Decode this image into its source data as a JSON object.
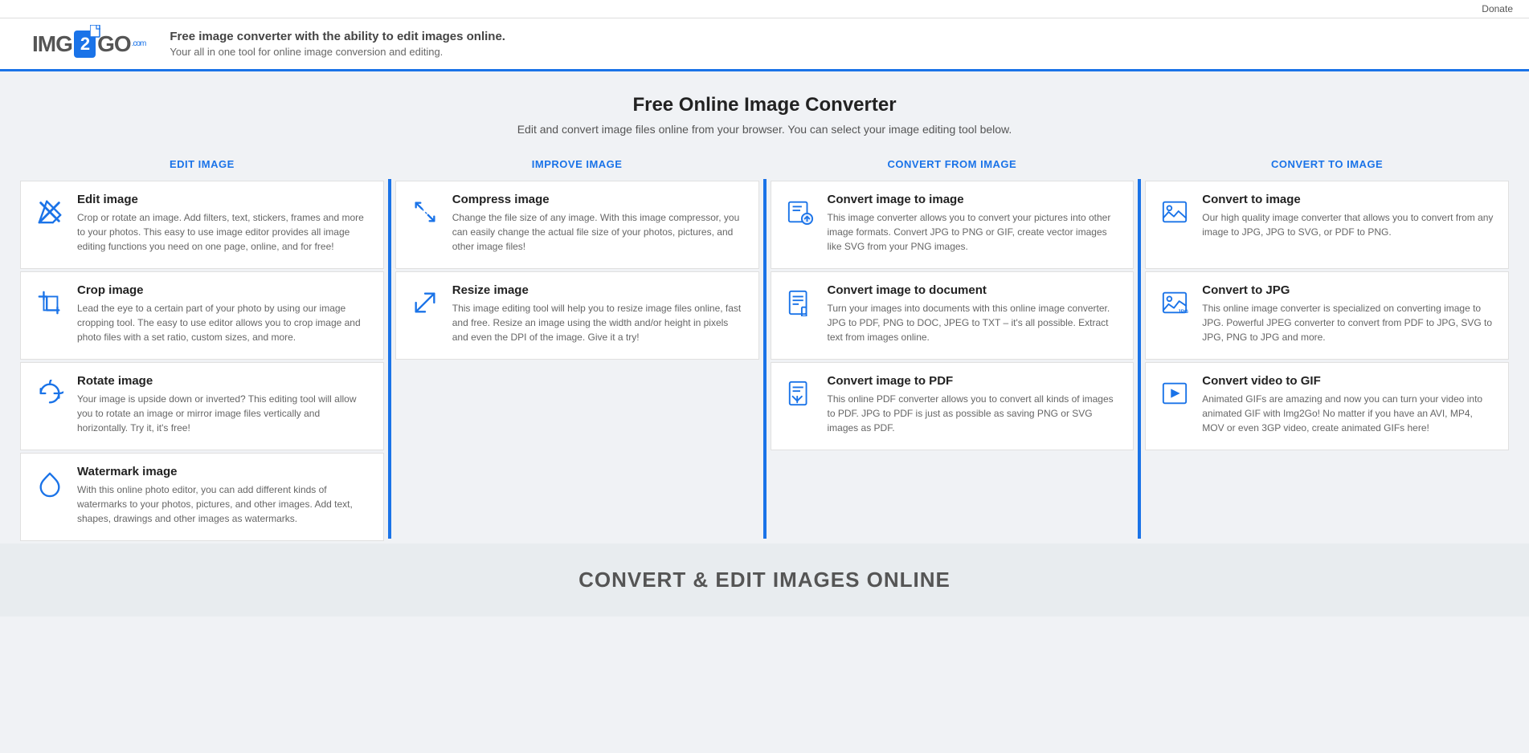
{
  "topbar": {
    "donate_label": "Donate"
  },
  "header": {
    "logo_text_left": "IMG",
    "logo_text_mid": "2",
    "logo_text_right": "GO",
    "logo_com": ".com",
    "tagline_bold": "Free image converter with the ability to edit images online.",
    "tagline_sub": "Your all in one tool for online image conversion and editing."
  },
  "hero": {
    "title": "Free Online Image Converter",
    "subtitle": "Edit and convert image files online from your browser. You can select your image editing tool below."
  },
  "columns": [
    {
      "id": "edit",
      "header": "EDIT IMAGE",
      "cards": [
        {
          "icon": "edit",
          "title": "Edit image",
          "description": "Crop or rotate an image. Add filters, text, stickers, frames and more to your photos. This easy to use image editor provides all image editing functions you need on one page, online, and for free!"
        },
        {
          "icon": "crop",
          "title": "Crop image",
          "description": "Lead the eye to a certain part of your photo by using our image cropping tool. The easy to use editor allows you to crop image and photo files with a set ratio, custom sizes, and more."
        },
        {
          "icon": "rotate",
          "title": "Rotate image",
          "description": "Your image is upside down or inverted? This editing tool will allow you to rotate an image or mirror image files vertically and horizontally. Try it, it's free!"
        },
        {
          "icon": "watermark",
          "title": "Watermark image",
          "description": "With this online photo editor, you can add different kinds of watermarks to your photos, pictures, and other images. Add text, shapes, drawings and other images as watermarks."
        }
      ]
    },
    {
      "id": "improve",
      "header": "IMPROVE IMAGE",
      "cards": [
        {
          "icon": "compress",
          "title": "Compress image",
          "description": "Change the file size of any image. With this image compressor, you can easily change the actual file size of your photos, pictures, and other image files!"
        },
        {
          "icon": "resize",
          "title": "Resize image",
          "description": "This image editing tool will help you to resize image files online, fast and free. Resize an image using the width and/or height in pixels and even the DPI of the image. Give it a try!"
        }
      ]
    },
    {
      "id": "convert-from",
      "header": "CONVERT FROM IMAGE",
      "cards": [
        {
          "icon": "convert-image",
          "title": "Convert image to image",
          "description": "This image converter allows you to convert your pictures into other image formats. Convert JPG to PNG or GIF, create vector images like SVG from your PNG images."
        },
        {
          "icon": "convert-doc",
          "title": "Convert image to document",
          "description": "Turn your images into documents with this online image converter. JPG to PDF, PNG to DOC, JPEG to TXT – it's all possible. Extract text from images online."
        },
        {
          "icon": "convert-pdf",
          "title": "Convert image to PDF",
          "description": "This online PDF converter allows you to convert all kinds of images to PDF. JPG to PDF is just as possible as saving PNG or SVG images as PDF."
        }
      ]
    },
    {
      "id": "convert-to",
      "header": "CONVERT TO IMAGE",
      "cards": [
        {
          "icon": "to-image",
          "title": "Convert to image",
          "description": "Our high quality image converter that allows you to convert from any image to JPG, JPG to SVG, or PDF to PNG."
        },
        {
          "icon": "to-jpg",
          "title": "Convert to JPG",
          "description": "This online image converter is specialized on converting image to JPG. Powerful JPEG converter to convert from PDF to JPG, SVG to JPG, PNG to JPG and more."
        },
        {
          "icon": "to-gif",
          "title": "Convert video to GIF",
          "description": "Animated GIFs are amazing and now you can turn your video into animated GIF with Img2Go! No matter if you have an AVI, MP4, MOV or even 3GP video, create animated GIFs here!"
        }
      ]
    }
  ],
  "bottom_banner": {
    "text": "CONVERT & EDIT IMAGES ONLINE"
  }
}
